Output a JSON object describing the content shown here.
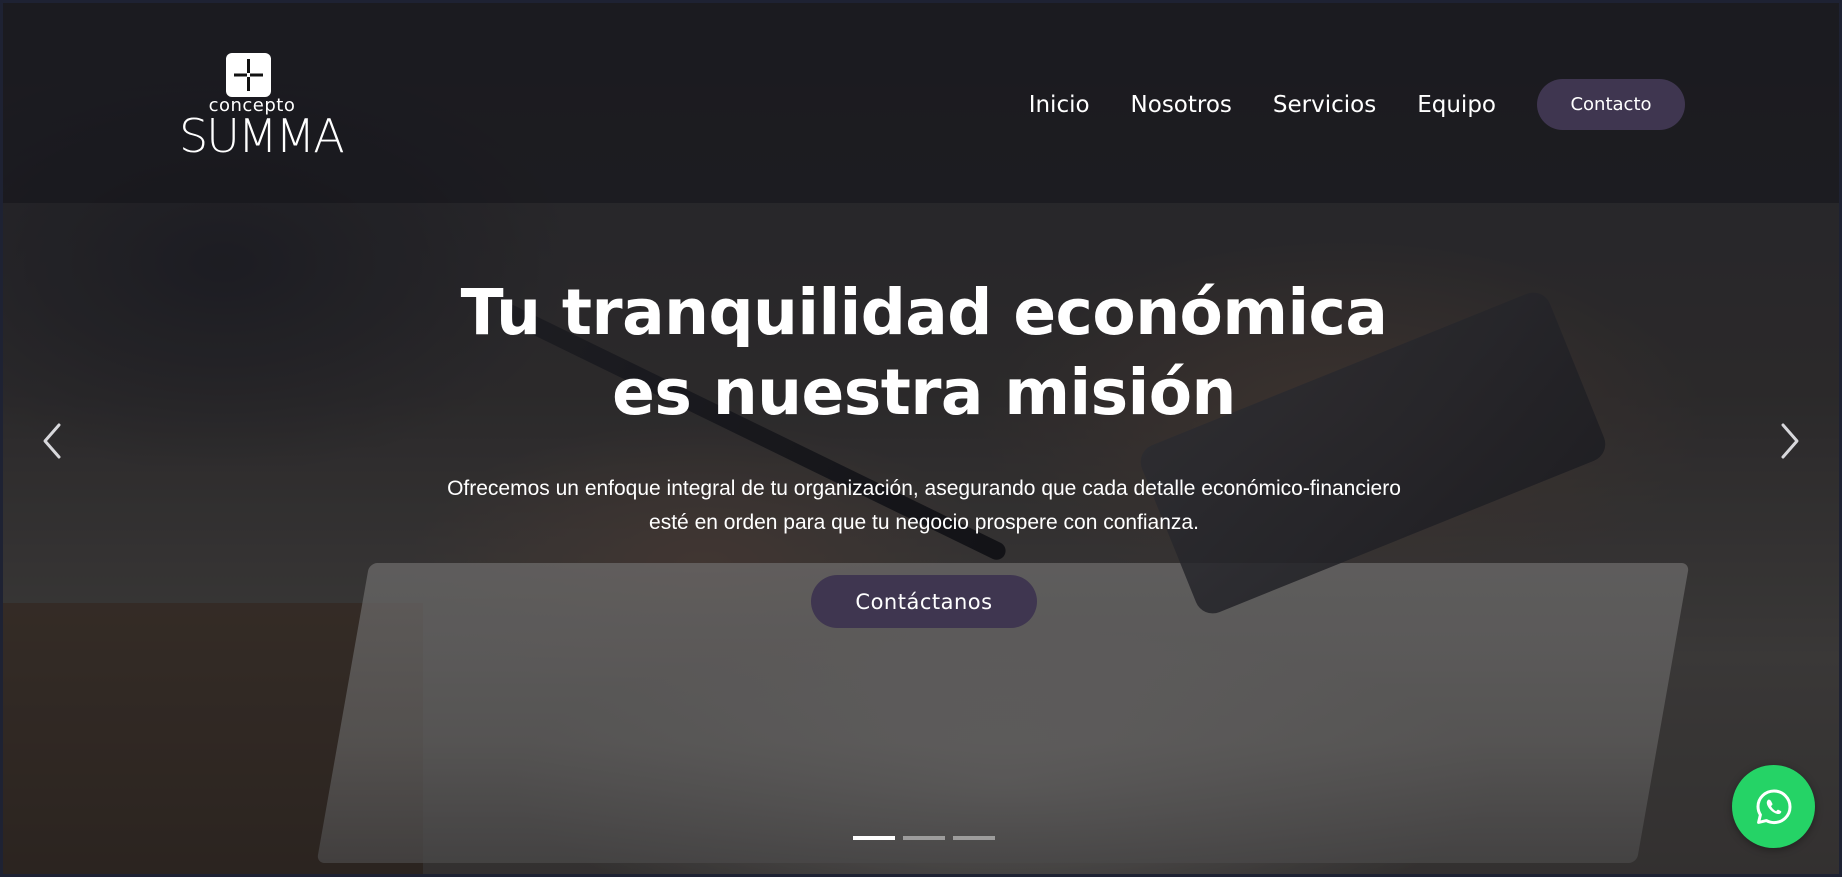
{
  "brand": {
    "logo_small": "concepto",
    "logo_big": "SUMMA"
  },
  "nav": {
    "items": [
      {
        "label": "Inicio"
      },
      {
        "label": "Nosotros"
      },
      {
        "label": "Servicios"
      },
      {
        "label": "Equipo"
      }
    ],
    "cta_label": "Contacto"
  },
  "hero": {
    "title": "Tu tranquilidad económica es nuestra misión",
    "subtitle": "Ofrecemos un enfoque integral de tu organización, asegurando que cada detalle económico-financiero esté en orden para que tu negocio prospere con confianza.",
    "cta_label": "Contáctanos"
  },
  "carousel": {
    "slide_count": 3,
    "active_index": 0,
    "prev_icon": "chevron-left-icon",
    "next_icon": "chevron-right-icon"
  },
  "floating": {
    "whatsapp_icon": "whatsapp-icon"
  },
  "colors": {
    "accent": "#3f3650",
    "whatsapp": "#25d366",
    "text": "#ffffff"
  }
}
